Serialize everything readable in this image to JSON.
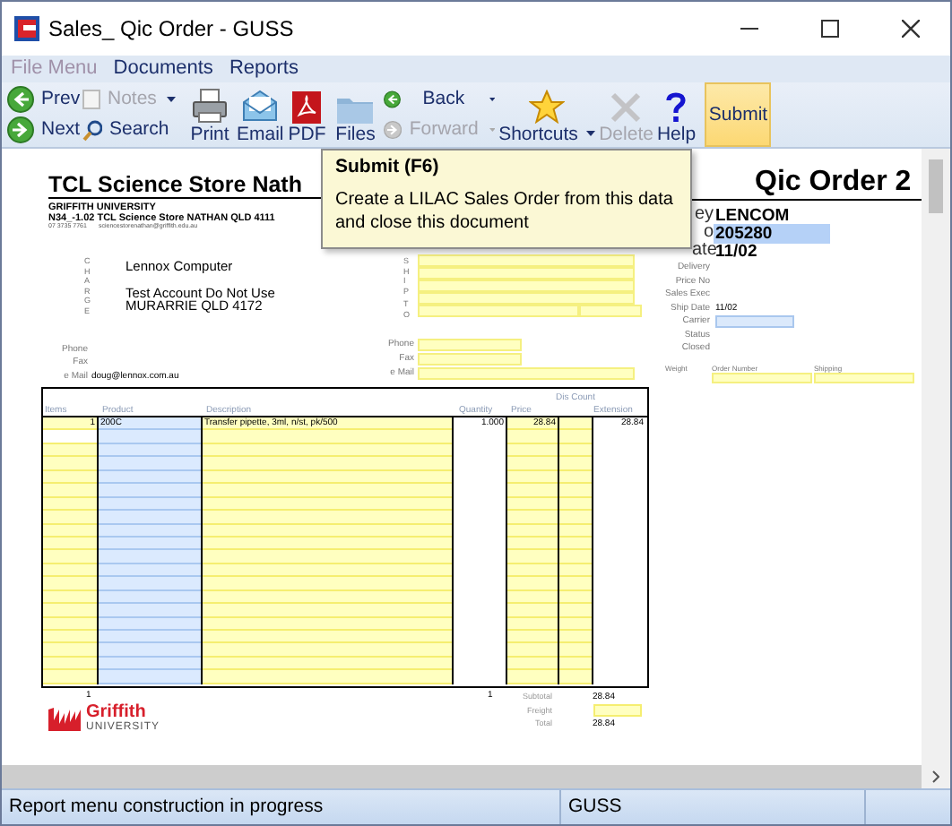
{
  "window": {
    "title": "Sales_ Qic Order - GUSS"
  },
  "menu": [
    {
      "label": "File Menu",
      "disabled": true
    },
    {
      "label": "Documents",
      "disabled": false
    },
    {
      "label": "Reports",
      "disabled": false
    }
  ],
  "toolbar": {
    "prev": {
      "label": "Prev",
      "disabled": false
    },
    "next": {
      "label": "Next",
      "disabled": false
    },
    "notes": {
      "label": "Notes",
      "disabled": true
    },
    "search": {
      "label": "Search",
      "disabled": false
    },
    "print": {
      "label": "Print",
      "disabled": false
    },
    "email": {
      "label": "Email",
      "disabled": false
    },
    "pdf": {
      "label": "PDF",
      "disabled": false
    },
    "files": {
      "label": "Files",
      "disabled": false
    },
    "back": {
      "label": "Back",
      "disabled": false
    },
    "forward": {
      "label": "Forward",
      "disabled": true
    },
    "shortcuts": {
      "label": "Shortcuts",
      "disabled": false
    },
    "delete": {
      "label": "Delete",
      "disabled": true
    },
    "help": {
      "label": "Help",
      "disabled": false
    },
    "submit": {
      "label": "Submit",
      "disabled": false,
      "highlighted": true
    }
  },
  "document": {
    "store_title": "TCL Science Store Nath",
    "order_title": "Qic Order 2",
    "org": "GRIFFITH UNIVERSITY",
    "address": "N34_-1.02 TCL Science Store NATHAN QLD 4111",
    "phone": "07 3735 7761",
    "email": "sciencestorenathan@griffith.edu.au",
    "charge": {
      "side_label": "CHARGE",
      "name": "Lennox Computer",
      "lines": [
        "Test Account Do Not Use",
        "MURARRIE QLD 4172"
      ]
    },
    "charge_contact": [
      {
        "label": "Phone"
      },
      {
        "label": "Fax"
      },
      {
        "label": "e Mail",
        "value": "doug@lennox.com.au"
      }
    ],
    "ship": {
      "side_label": [
        "SHIP",
        "TO"
      ]
    },
    "ship_contact": [
      {
        "label": "Phone"
      },
      {
        "label": "Fax"
      },
      {
        "label": "e Mail"
      }
    ],
    "details": [
      {
        "label": "ey",
        "value": "LENCOM",
        "kind": "bold"
      },
      {
        "label": "o",
        "value": "205280",
        "kind": "bold-field"
      },
      {
        "label": "ate",
        "value": "11/02",
        "kind": "bold"
      },
      {
        "label": "Delivery",
        "kind": "plain"
      },
      {
        "label": "Price No",
        "kind": "plain"
      },
      {
        "label": "Sales Exec",
        "kind": "plain"
      },
      {
        "label": "Ship Date",
        "value": "11/02",
        "kind": "plain"
      },
      {
        "label": "Carrier",
        "kind": "field"
      },
      {
        "label": "Status",
        "kind": "plain"
      },
      {
        "label": "Closed",
        "kind": "plain"
      }
    ],
    "shipping": [
      {
        "label": "Weight",
        "kind": "plain"
      },
      {
        "label": "Order Number",
        "kind": "field"
      },
      {
        "label": "Shipping",
        "kind": "field"
      }
    ],
    "table": {
      "discount_heading": "Dis Count",
      "columns": [
        "Items",
        "Product",
        "Description",
        "Quantity",
        "Price",
        "Extension"
      ],
      "rows": [
        {
          "items": "1",
          "product": "200C",
          "description": "Transfer pipette, 3ml, n/st, pk/500",
          "quantity": "1.000",
          "price": "28.84",
          "extension": "28.84"
        }
      ]
    },
    "totals": {
      "item_count": "1",
      "quantity_total": "1",
      "subtotal_label": "Subtotal",
      "subtotal": "28.84",
      "freight_label": "Freight",
      "total_label": "Total",
      "total": "28.84"
    },
    "logo": {
      "name": "Griffith",
      "subtitle": "UNIVERSITY"
    }
  },
  "tooltip": {
    "title": "Submit (F6)",
    "text": "Create a LILAC Sales Order from this data and close this document"
  },
  "status_bar": [
    "Report menu construction in progress",
    "GUSS"
  ]
}
